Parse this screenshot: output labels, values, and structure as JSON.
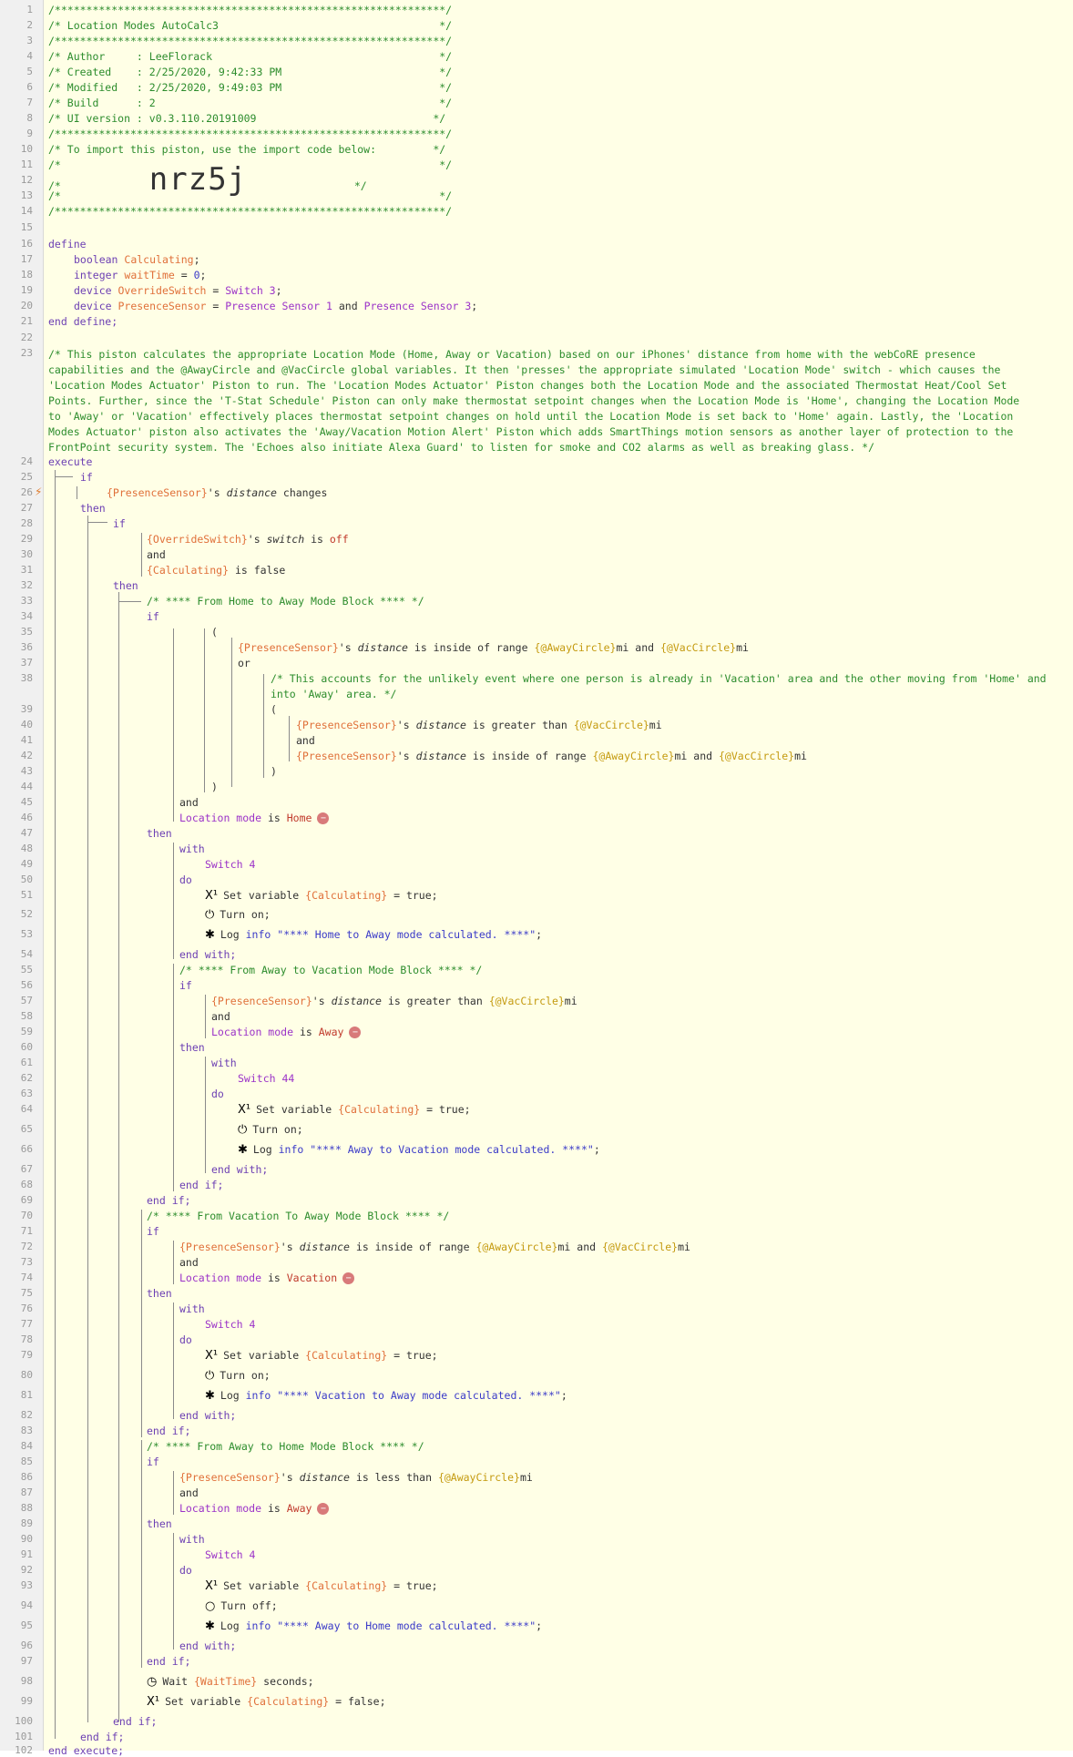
{
  "gutter": {
    "line_numbers": [
      "1",
      "2",
      "3",
      "4",
      "5",
      "6",
      "7",
      "8",
      "9",
      "10",
      "11",
      "12",
      "13",
      "14",
      "15",
      "16",
      "17",
      "18",
      "19",
      "20",
      "21",
      "22",
      "23",
      "24",
      "25",
      "26",
      "27",
      "28",
      "29",
      "30",
      "31",
      "32",
      "33",
      "34",
      "35",
      "36",
      "37",
      "38",
      "39",
      "40",
      "41",
      "42",
      "43",
      "44",
      "45",
      "46",
      "47",
      "48",
      "49",
      "50",
      "51",
      "52",
      "53",
      "54",
      "55",
      "56",
      "57",
      "58",
      "59",
      "60",
      "61",
      "62",
      "63",
      "64",
      "65",
      "66",
      "67",
      "68",
      "69",
      "70",
      "71",
      "72",
      "73",
      "74",
      "75",
      "76",
      "77",
      "78",
      "79",
      "80",
      "81",
      "82",
      "83",
      "84",
      "85",
      "86",
      "87",
      "88",
      "89",
      "90",
      "91",
      "92",
      "93",
      "94",
      "95",
      "96",
      "97",
      "98",
      "99",
      "100",
      "101",
      "102"
    ]
  },
  "header": {
    "border": "/**************************************************************/",
    "title": "/* Location Modes AutoCalc3                                   */",
    "author": "/* Author     : LeeFlorack                                    */",
    "created": "/* Created    : 2/25/2020, 9:42:33 PM                         */",
    "modified": "/* Modified   : 2/25/2020, 9:49:03 PM                         */",
    "build": "/* Build      : 2                                             */",
    "ui_version": "/* UI version : v0.3.110.20191009                            */",
    "import_line": "/* To import this piston, use the import code below:         */",
    "blank": "/*                                                            */",
    "code_prefix": "/*              ",
    "import_code": "nrz5j",
    "code_suffix": "                 */"
  },
  "define": {
    "open": "define",
    "close": "end define;",
    "types": [
      "boolean",
      "integer",
      "device",
      "device"
    ],
    "vars": [
      "Calculating",
      "waitTime",
      "OverrideSwitch",
      "PresenceSensor"
    ],
    "wait_default": "0",
    "switch3": "Switch 3",
    "sensor1": "Presence Sensor 1",
    "sensor3": "Presence Sensor 3",
    "and": "and"
  },
  "description": "/* This piston calculates the appropriate Location Mode (Home, Away or Vacation) based on our iPhones' distance from home with the webCoRE presence capabilities and the @AwayCircle and @VacCircle global variables. It then 'presses' the appropriate simulated 'Location Mode' switch - which causes the 'Location Modes Actuator' Piston to run. The 'Location Modes Actuator' Piston changes both the Location Mode and the associated Thermostat Heat/Cool Set Points. Further, since the 'T-Stat Schedule' Piston can only make thermostat setpoint changes when the Location Mode is 'Home', changing the Location Mode to 'Away' or 'Vacation' effectively places thermostat setpoint changes on hold until the Location Mode is set back to 'Home' again. Lastly, the 'Location Modes Actuator' piston also activates the 'Away/Vacation Motion Alert' Piston which adds SmartThings motion sensors as another layer of protection to the FrontPoint security system. The 'Echoes also initiate Alexa Guard' to listen for smoke and CO2 alarms as well as breaking glass. */",
  "kw": {
    "execute": "execute",
    "end_execute": "end execute;",
    "if": "if",
    "then": "then",
    "end_if": "end if;",
    "and": "and",
    "or": "or",
    "with": "with",
    "do": "do",
    "end_with": "end with;",
    "open_paren": "(",
    "close_paren": ")",
    "is": "is",
    "is_false": "is false",
    "is_off": "is",
    "off": "off",
    "changes": "changes",
    "sq": "'s",
    "distance": "distance",
    "location_mode": "Location mode",
    "mi": "mi"
  },
  "conds": {
    "presence": "{PresenceSensor}",
    "override": "{OverrideSwitch}",
    "calculating": "{Calculating}",
    "switch_attr": "switch",
    "away_circle": "{@AwayCircle}",
    "vac_circle": "{@VacCircle}",
    "inside_range": "is inside of range",
    "greater": "is greater than",
    "less": "is less than",
    "wait_time": "{WaitTime}"
  },
  "comments": {
    "home_away": "/* **** From Home to Away Mode Block **** */",
    "away_vac": "/* **** From Away to Vacation Mode Block **** */",
    "vac_away": "/* **** From Vacation To Away Mode Block **** */",
    "away_home": "/* **** From Away to Home Mode Block **** */",
    "unlikely_1": "/* This accounts for the unlikely event where one person is already in 'Vacation' area and the other moving from 'Home' and",
    "unlikely_2": "into 'Away' area. */"
  },
  "modes": {
    "home": "Home",
    "away": "Away",
    "vacation": "Vacation"
  },
  "devices": {
    "switch4": "Switch 4",
    "switch44": "Switch 44"
  },
  "actions": {
    "set_variable": "Set variable",
    "eq_true": "= true;",
    "eq_false": "= false;",
    "turn_on": "Turn on;",
    "turn_off": "Turn off;",
    "log": "Log",
    "info": "info",
    "msg_home_away": "\"**** Home to Away mode calculated. ****\"",
    "msg_away_vac": "\"**** Away to Vacation mode calculated. ****\"",
    "msg_vac_away": "\"**** Vacation to Away mode calculated. ****\"",
    "msg_away_home": "\"**** Away to Home mode calculated. ****\"",
    "semicolon": ";",
    "wait": "Wait",
    "seconds": "seconds;"
  },
  "icons": {
    "set_variable": "X1",
    "power_on": "power-icon",
    "power_off": "power-off-icon",
    "bug": "bug-icon",
    "timer": "timer-icon",
    "trigger": "lightning-icon",
    "remove": "minus-circle-icon"
  },
  "colors": {
    "background": "#ffffe6",
    "keyword": "#6c3fb3",
    "variable": "#e0703a",
    "device": "#9b32c8",
    "comment": "#2c8c2c",
    "string": "#3a3ac8",
    "value": "#c0392b"
  }
}
